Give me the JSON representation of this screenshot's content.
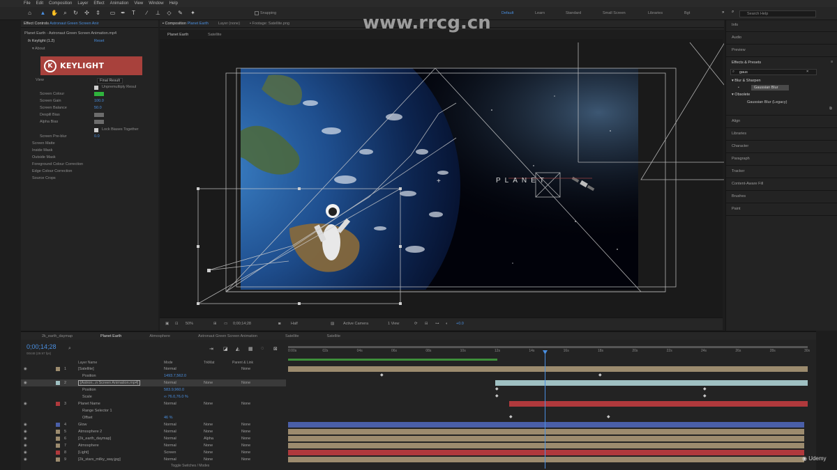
{
  "menu": [
    "File",
    "Edit",
    "Composition",
    "Layer",
    "Effect",
    "Animation",
    "View",
    "Window",
    "Help"
  ],
  "toolbar": {
    "snapping": "Snapping",
    "workspaces": [
      {
        "label": "Default",
        "active": true
      },
      {
        "label": "Learn",
        "active": false
      },
      {
        "label": "Standard",
        "active": false
      },
      {
        "label": "Small Screen",
        "active": false
      },
      {
        "label": "Libraries",
        "active": false
      },
      {
        "label": "Bgt",
        "active": false
      }
    ],
    "search_placeholder": "Search Help"
  },
  "watermark_site": "www.rrcg.cn",
  "effect_controls": {
    "tab_prefix": "Effect Controls",
    "tab_file": "Astronaut Green Screen Anir",
    "breadcrumb": "Planet Earth - Astronaut Green Screen Animation.mp4",
    "fx_name": "Keylight (1.2)",
    "reset": "Reset",
    "about": "About",
    "logo_text": "KEYLIGHT",
    "rows": [
      {
        "label": "View",
        "value": "Final Result"
      },
      {
        "label": "Unpremultiply Resul",
        "value": ""
      },
      {
        "label": "Screen Colour",
        "value": ""
      },
      {
        "label": "Screen Gain",
        "value": "100.0"
      },
      {
        "label": "Screen Balance",
        "value": "50.0"
      },
      {
        "label": "Despill Bias",
        "value": ""
      },
      {
        "label": "Alpha Bias",
        "value": ""
      },
      {
        "label": "Lock Biases Together",
        "value": ""
      },
      {
        "label": "Screen Pre-blur",
        "value": "0.0"
      },
      {
        "label": "Screen Matte",
        "value": ""
      },
      {
        "label": "Inside Mask",
        "value": ""
      },
      {
        "label": "Outside Mask",
        "value": ""
      },
      {
        "label": "Foreground Colour Correction",
        "value": ""
      },
      {
        "label": "Edge Colour Correction",
        "value": ""
      },
      {
        "label": "Source Crops",
        "value": ""
      }
    ]
  },
  "composition": {
    "tab_prefix": "Composition",
    "tab_name": "Planet Earth",
    "layer_tab": "Layer (none)",
    "footage_tab": "Footage: Satellite.png",
    "sub_tabs": [
      "Planet Earth",
      "Satellite"
    ],
    "overlay_text": "PLANET",
    "viewer_bar": {
      "zoom": "50%",
      "time": "0;00;14;28",
      "resolution": "Half",
      "camera": "Active Camera",
      "views": "1 View",
      "exposure": "+0.0"
    }
  },
  "right_panels": {
    "items_top": [
      "Info",
      "Audio",
      "Preview"
    ],
    "effects_title": "Effects & Presets",
    "effects_search": "gaus",
    "category1": "Blur & Sharpen",
    "effect1": "Gaussian Blur",
    "category2": "Obsolete",
    "effect2": "Gaussian Blur (Legacy)",
    "items_bottom": [
      "Align",
      "Libraries",
      "Character",
      "Paragraph",
      "Tracker",
      "Content-Aware Fill",
      "Brushes",
      "Paint"
    ]
  },
  "timeline": {
    "tabs": [
      {
        "label": "2k_earth_daymap",
        "active": false
      },
      {
        "label": "Planet Earth",
        "active": true
      },
      {
        "label": "Atmosphere",
        "active": false
      },
      {
        "label": "Astronaut Green Screen Animation",
        "active": false
      },
      {
        "label": "Satellite",
        "active": false
      },
      {
        "label": "Satellite",
        "active": false
      }
    ],
    "current_time": "0;00;14;28",
    "frames": "00448 (29.97 fps)",
    "columns": {
      "layer_name": "Layer Name",
      "mode": "Mode",
      "trkmat": "TrkMat",
      "parent": "Parent & Link"
    },
    "ruler": [
      "0:00s",
      "02s",
      "04s",
      "06s",
      "08s",
      "10s",
      "12s",
      "14s",
      "16s",
      "18s",
      "20s",
      "22s",
      "24s",
      "26s",
      "28s",
      "30s"
    ],
    "layers": [
      {
        "num": "1",
        "name": "[Satellite]",
        "mode": "Normal",
        "trk": "",
        "parent": "None",
        "color": "#9c8b6e"
      },
      {
        "num": "",
        "name": "Position",
        "mode": "1493.7,562.0",
        "trk": "",
        "parent": "",
        "color": ""
      },
      {
        "num": "2",
        "name": "[Astron...n Screen Animation.mp4]",
        "mode": "Normal",
        "trk": "None",
        "parent": "None",
        "color": "#9fc0c2"
      },
      {
        "num": "",
        "name": "Position",
        "mode": "583.9,960.0",
        "trk": "",
        "parent": "",
        "color": ""
      },
      {
        "num": "",
        "name": "Scale",
        "mode": "∞ 76.0,76.0 %",
        "trk": "",
        "parent": "",
        "color": ""
      },
      {
        "num": "3",
        "name": "Planet Name",
        "mode": "Normal",
        "trk": "None",
        "parent": "None",
        "color": "#b0393c"
      },
      {
        "num": "",
        "name": "Range Selector 1",
        "mode": "",
        "trk": "",
        "parent": "",
        "color": ""
      },
      {
        "num": "",
        "name": "Offset",
        "mode": "46 %",
        "trk": "",
        "parent": "",
        "color": ""
      },
      {
        "num": "4",
        "name": "Glow",
        "mode": "Normal",
        "trk": "None",
        "parent": "None",
        "color": "#4a5fa8"
      },
      {
        "num": "5",
        "name": "Atmosphere 2",
        "mode": "Normal",
        "trk": "None",
        "parent": "None",
        "color": "#9c8b6e"
      },
      {
        "num": "6",
        "name": "[2k_earth_daymap]",
        "mode": "Normal",
        "trk": "Alpha",
        "parent": "None",
        "color": "#9c8b6e"
      },
      {
        "num": "7",
        "name": "Atmosphere",
        "mode": "Normal",
        "trk": "None",
        "parent": "None",
        "color": "#9c8b6e"
      },
      {
        "num": "8",
        "name": "[Light]",
        "mode": "Screen",
        "trk": "None",
        "parent": "None",
        "color": "#b0393c"
      },
      {
        "num": "9",
        "name": "[2k_stars_milky_way.jpg]",
        "mode": "Normal",
        "trk": "None",
        "parent": "None",
        "color": "#9c8b6e"
      }
    ],
    "footer": "Toggle Switches / Modes"
  },
  "udemy": "Udemy",
  "accent": "#4a8fe0"
}
